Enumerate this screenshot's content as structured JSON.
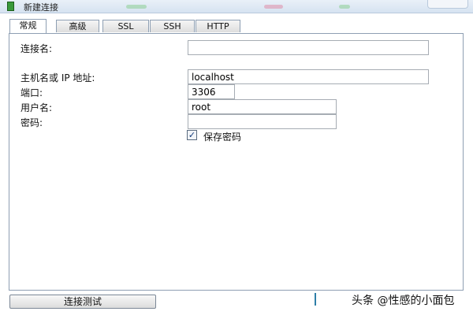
{
  "window": {
    "title": "新建连接"
  },
  "tabs": [
    {
      "label": "常规",
      "active": true
    },
    {
      "label": "高级",
      "active": false
    },
    {
      "label": "SSL",
      "active": false
    },
    {
      "label": "SSH",
      "active": false
    },
    {
      "label": "HTTP",
      "active": false
    }
  ],
  "form": {
    "connection_name": {
      "label": "连接名:",
      "value": ""
    },
    "host": {
      "label": "主机名或 IP 地址:",
      "value": "localhost"
    },
    "port": {
      "label": "端口:",
      "value": "3306"
    },
    "username": {
      "label": "用户名:",
      "value": "root"
    },
    "password": {
      "label": "密码:",
      "value": ""
    },
    "save_password": {
      "label": "保存密码",
      "checked": true,
      "glyph": "✓"
    }
  },
  "footer": {
    "test_button_label": "连接测试",
    "watermark": "头条 @性感的小面包"
  },
  "colors": {
    "tab_border": "#8e9fb3",
    "field_border": "#a6acb3",
    "titlebar": "#d6e3f1"
  }
}
